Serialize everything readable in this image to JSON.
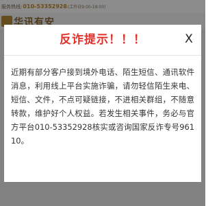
{
  "background": {
    "hotline_label": "服务热线:",
    "hotline_number": "010-53352928",
    "hotline_hours": "(工作日9:00-18:00)",
    "logo_text": "华讯有安"
  },
  "dialog": {
    "title": "反诈提示！！！",
    "close_label": "X",
    "message": "近期有部分客户接到境外电话、陌生短信、通讯软件消息，利用线上平台实施诈骗，请勿轻信陌生来电、短信、文件，不点可疑链接，不进相关群组，不随意转款，维护好个人权益。若发生相关事件，务必与官方平台010-53352928核实或咨询国家反诈专号96110。"
  },
  "colors": {
    "title": "#e0302a",
    "overlay": "rgba(0,0,0,0.45)",
    "accent": "#c08a2a"
  }
}
